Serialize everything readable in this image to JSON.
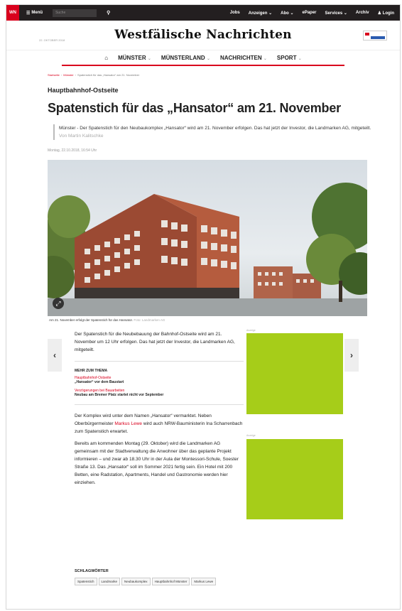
{
  "topbar": {
    "logo": "WN",
    "menu_label": "Menü",
    "search_placeholder": "Suche",
    "nav": [
      "Jobs",
      "Anzeigen",
      "Abo",
      "ePaper",
      "Services",
      "Archiv",
      "Login"
    ]
  },
  "masthead": {
    "brand": "Westfälische Nachrichten",
    "date": "22. OKTOBER 2018"
  },
  "section_nav": [
    {
      "label": "MÜNSTER",
      "has_dropdown": true
    },
    {
      "label": "MÜNSTERLAND",
      "has_dropdown": true
    },
    {
      "label": "NACHRICHTEN",
      "has_dropdown": true
    },
    {
      "label": "SPORT",
      "has_dropdown": true
    }
  ],
  "breadcrumb": [
    "Startseite",
    "Münster",
    "Spatenstich für das „Hansator“ am 21. November"
  ],
  "article": {
    "kicker": "Hauptbahnhof-Ostseite",
    "headline": "Spatenstich für das „Hansator“ am 21. November",
    "lead": "Münster - Der Spatenstich für den Neubaukomplex „Hansator“ wird am 21. November erfolgen. Das hat jetzt der Investor, die Landmarken AG, mitgeteilt.",
    "author": "Von Martin Kalitschke",
    "date": "Montag, 22.10.2018, 16:54 Uhr",
    "caption": "Am 21. November erfolgt der Spatenstich für das Hansator.",
    "caption_credit": "Foto: Landmarken AG",
    "para1": "Der Spatenstich für die Neubebauung der Bahnhof-Ostseite wird am 21. November um 12 Uhr erfolgen. Das hat jetzt der Investor, die Landmarken AG, mitgeteilt.",
    "more_title": "MEHR ZUM THEMA",
    "more": [
      {
        "kicker": "Hauptbahnhof-Ostseite",
        "title": "„Hansator“ vor dem Baustart"
      },
      {
        "kicker": "Verzögerungen bei Bauarbeiten",
        "title": "Neubau am Bremer Platz startet nicht vor September"
      }
    ],
    "para2_before": "Der Komplex wird unter dem Namen „Hansator“ vermarktet. Neben Oberbürgermeister ",
    "para2_link": "Markus Lewe",
    "para2_after": " wird auch NRW-Bauministerin Ina Scharrenbach zum Spatenstich erwartet.",
    "para3": "Bereits am kommenden Montag (29. Oktober) wird die Landmarken AG gemeinsam mit der Stadtverwaltung die Anwohner über das geplante Projekt informieren – und zwar ab 18.30 Uhr in der Aula der Montessori-Schule, Soester Straße 13. Das „Hansator“ soll im Sommer 2021 fertig sein. Ein Hotel mit 200 Betten, eine Radstation, Apartments, Handel und Gastronomie werden hier einziehen.",
    "ad_label": "Anzeige",
    "tags_title": "SCHLAGWÖRTER",
    "tags": [
      "Spatenstich",
      "Landmarke",
      "Neubaukomplex",
      "Hauptbahnhof Münster",
      "Markus Lewe"
    ]
  },
  "colors": {
    "brand_red": "#d9001d",
    "ad_green": "#a6cd19",
    "topbar": "#231f20"
  }
}
